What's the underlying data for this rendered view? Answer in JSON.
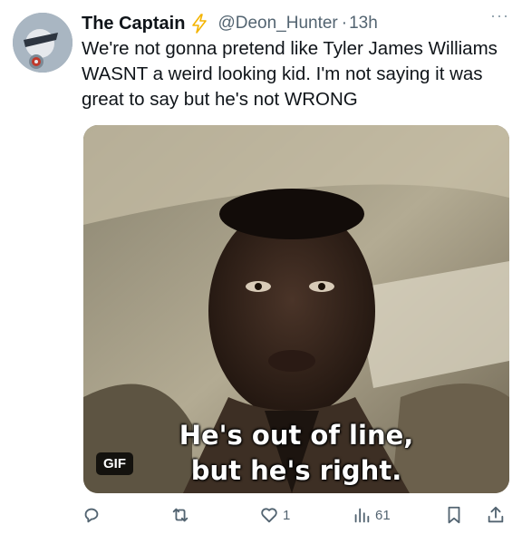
{
  "tweet": {
    "author_name": "The Captain",
    "handle": "@Deon_Hunter",
    "separator": "·",
    "time": "13h",
    "more_label": "···",
    "text": "We're not gonna pretend like Tyler James Williams WASNT a weird looking kid. I'm not saying it was great to say but he's not WRONG",
    "badge_icon": "lightning-bolt-icon",
    "badge_color": "#f4b400"
  },
  "media": {
    "caption_line1": "He's out of line,",
    "caption_line2": "but he's right.",
    "gif_badge": "GIF"
  },
  "actions": {
    "reply_icon": "reply-icon",
    "reply_count": "",
    "retweet_icon": "retweet-icon",
    "retweet_count": "",
    "like_icon": "heart-icon",
    "like_count": "1",
    "views_icon": "views-icon",
    "views_count": "61",
    "bookmark_icon": "bookmark-icon",
    "share_icon": "share-icon"
  },
  "colors": {
    "text": "#0f1419",
    "secondary": "#536471"
  }
}
